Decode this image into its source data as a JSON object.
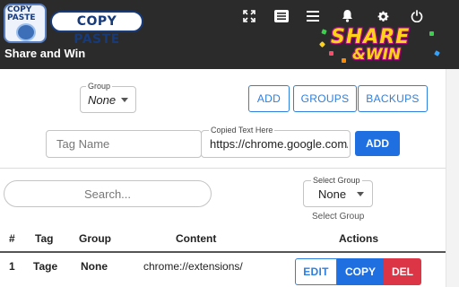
{
  "header": {
    "logo_badge_text": "COPY\nPASTE",
    "logo_text": "COPY PASTE",
    "title": "Share and Win",
    "banner_line1": "SHARE",
    "banner_line2": "&WIN",
    "icons": [
      "fullscreen-icon",
      "list-view-icon",
      "menu-icon",
      "bell-icon",
      "gear-icon",
      "power-icon"
    ]
  },
  "group_filter": {
    "legend": "Group",
    "value": "None"
  },
  "actions": {
    "add_label": "ADD",
    "groups_label": "GROUPS",
    "backups_label": "BACKUPS"
  },
  "entry": {
    "tag_placeholder": "Tag Name",
    "copied_legend": "Copied Text Here",
    "copied_value": "https://chrome.google.com/",
    "add_label": "ADD"
  },
  "search": {
    "placeholder": "Search...",
    "select_legend": "Select Group",
    "select_value": "None",
    "select_helper": "Select Group"
  },
  "table": {
    "headers": [
      "#",
      "Tag",
      "Group",
      "Content",
      "Actions"
    ],
    "rows": [
      {
        "num": "1",
        "tag": "Tage",
        "group": "None",
        "content": "chrome://extensions/",
        "edit": "EDIT",
        "copy": "COPY",
        "del": "DEL"
      }
    ]
  },
  "colors": {
    "header_bg": "#2b2b2b",
    "primary": "#1f6fe0",
    "danger": "#dc3545"
  }
}
